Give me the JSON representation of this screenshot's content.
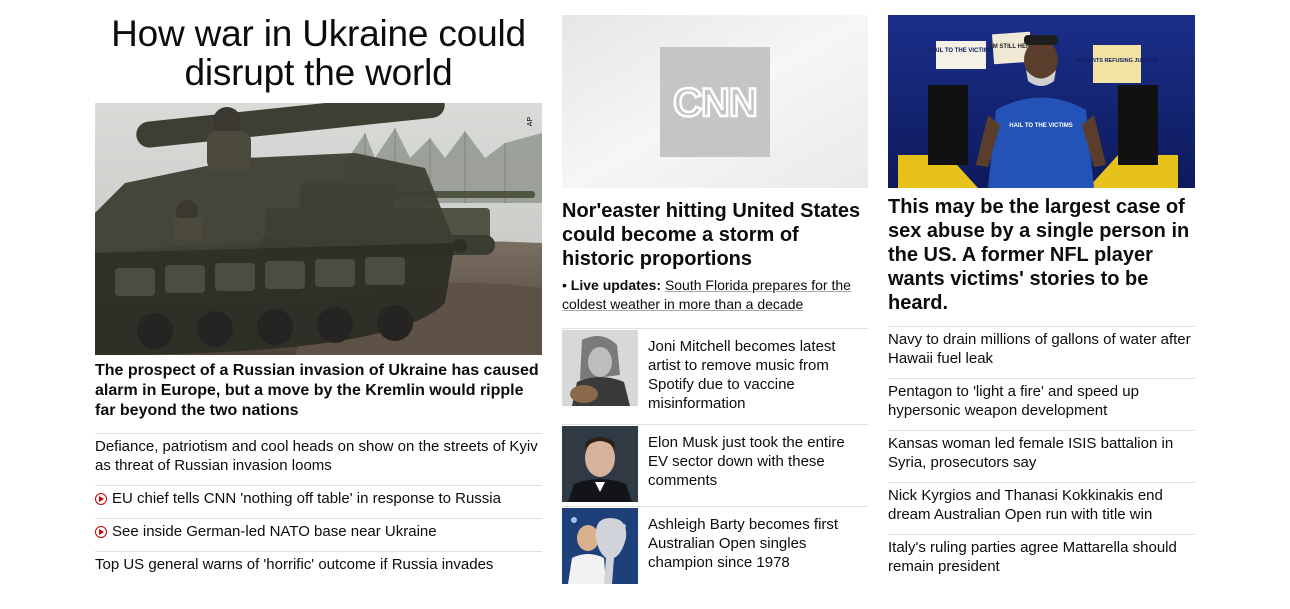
{
  "col1": {
    "zone_title": "How war in Ukraine could disrupt the world",
    "hero_credit": "AP",
    "lead": "The prospect of a Russian invasion of Ukraine has caused alarm in Europe, but a move by the Kremlin would ripple far beyond the two nations",
    "items": [
      {
        "text": "Defiance, patriotism and cool heads on show on the streets of Kyiv as threat of Russian invasion looms",
        "video": false
      },
      {
        "text": "EU chief tells CNN 'nothing off table' in response to Russia",
        "video": true
      },
      {
        "text": "See inside German-led NATO base near Ukraine",
        "video": true
      },
      {
        "text": "Top US general warns of 'horrific' outcome if Russia invades",
        "video": false
      }
    ]
  },
  "col2": {
    "hero_logo": "CNN",
    "lead": "Nor'easter hitting United States could become a storm of historic proportions",
    "live_label": "Live updates:",
    "live_text": "South Florida prepares for the coldest weather in more than a decade",
    "thumbs": [
      {
        "text": "Joni Mitchell becomes latest artist to remove music from Spotify due to vaccine misinformation"
      },
      {
        "text": "Elon Musk just took the entire EV sector down with these comments"
      },
      {
        "text": "Ashleigh Barty becomes first Australian Open singles champion since 1978"
      }
    ]
  },
  "col3": {
    "hero_signs": [
      "HAIL TO THE VICTIMS",
      "REGENTS REFUSING JUSTICE",
      "I'M STILL HERE",
      "HAIL TO THE VICTIMS"
    ],
    "lead": "This may be the largest case of sex abuse by a single person in the US. A former NFL player wants victims' stories to be heard.",
    "items": [
      {
        "text": "Navy to drain millions of gallons of water after Hawaii fuel leak"
      },
      {
        "text": "Pentagon to 'light a fire' and speed up hypersonic weapon development"
      },
      {
        "text": "Kansas woman led female ISIS battalion in Syria, prosecutors say"
      },
      {
        "text": "Nick Kyrgios and Thanasi Kokkinakis end dream Australian Open run with title win"
      },
      {
        "text": "Italy's ruling parties agree Mattarella should remain president"
      }
    ]
  },
  "colors": {
    "accent_red": "#cc0000",
    "divider": "#e0e0e0",
    "text": "#0c0c0c"
  }
}
